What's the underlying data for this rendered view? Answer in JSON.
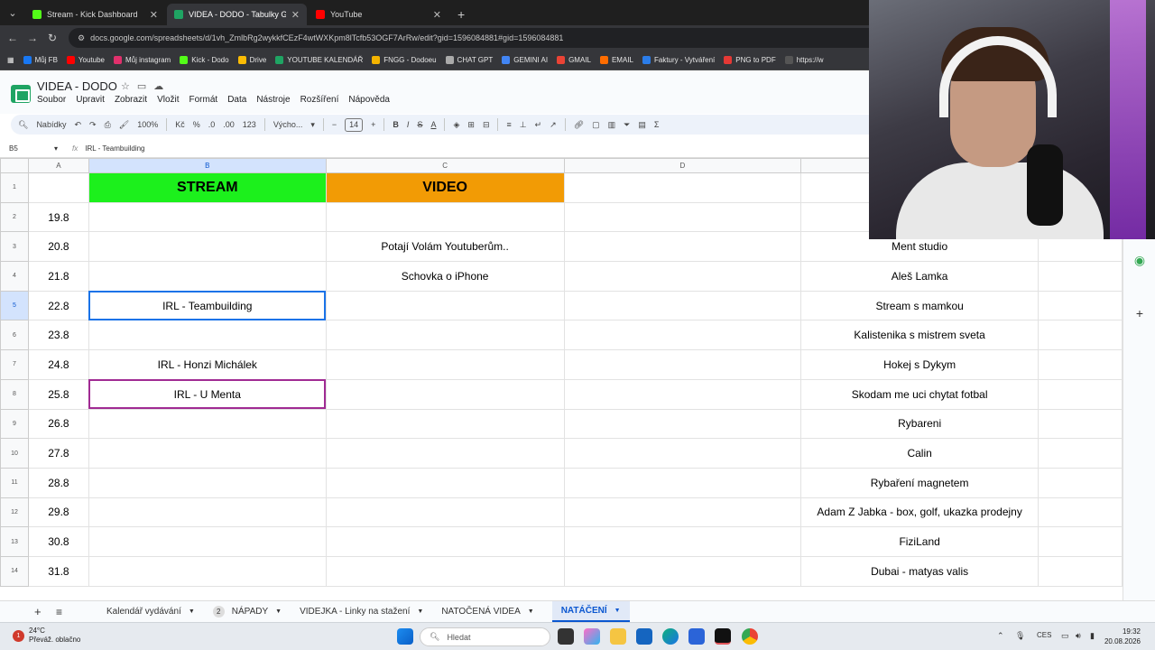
{
  "browser": {
    "tabs": [
      {
        "label": "Stream - Kick Dashboard",
        "color": "#53fc18",
        "active": false
      },
      {
        "label": "VIDEA - DODO - Tabulky Goog",
        "color": "#1fa463",
        "active": true
      },
      {
        "label": "YouTube",
        "color": "#ff0000",
        "active": false
      }
    ],
    "url": "docs.google.com/spreadsheets/d/1vh_ZmlbRg2wykkfCEzF4wtWXKpm8lTcfb53OGF7ArRw/edit?gid=1596084881#gid=1596084881",
    "bookmarks": [
      {
        "label": "Můj FB",
        "color": "#1877f2"
      },
      {
        "label": "Youtube",
        "color": "#ff0000"
      },
      {
        "label": "Můj instagram",
        "color": "#e1306c"
      },
      {
        "label": "Kick - Dodo",
        "color": "#53fc18"
      },
      {
        "label": "Drive",
        "color": "#fbbc04"
      },
      {
        "label": "YOUTUBE KALENDÁŘ",
        "color": "#1fa463"
      },
      {
        "label": "FNGG - Dodoeu",
        "color": "#f4b400"
      },
      {
        "label": "CHAT GPT",
        "color": "#aaaaaa"
      },
      {
        "label": "GEMINI AI",
        "color": "#4285f4"
      },
      {
        "label": "GMAIL",
        "color": "#ea4335"
      },
      {
        "label": "EMAIL",
        "color": "#ff6d00"
      },
      {
        "label": "Faktury - Vytváření",
        "color": "#2b7de9"
      },
      {
        "label": "PNG to PDF",
        "color": "#e53935"
      },
      {
        "label": "https://w",
        "color": "#555555"
      }
    ]
  },
  "sheets": {
    "title": "VIDEA - DODO",
    "menus": [
      "Soubor",
      "Upravit",
      "Zobrazit",
      "Vložit",
      "Formát",
      "Data",
      "Nástroje",
      "Rozšíření",
      "Nápověda"
    ],
    "toolbar": {
      "search": "Nabídky",
      "zoom": "100%",
      "currency": "Kč",
      "percent": "%",
      "dec_down": ".0",
      "dec_up": ".00",
      "num": "123",
      "font": "Výcho...",
      "font_size": "14",
      "bold": "B",
      "italic": "I",
      "strike": "S",
      "textcolor": "A"
    },
    "namebox": "B5",
    "formula": "IRL - Teambuilding",
    "columns": [
      "A",
      "B",
      "C",
      "D"
    ],
    "headers": {
      "stream": "STREAM",
      "video": "VIDEO"
    },
    "rows": [
      {
        "num": "2",
        "date": "19.8",
        "stream": "",
        "video": "",
        "e": ""
      },
      {
        "num": "3",
        "date": "20.8",
        "stream": "",
        "video": "Potají Volám Youtuberům..",
        "e": "Ment studio"
      },
      {
        "num": "4",
        "date": "21.8",
        "stream": "",
        "video": "Schovka o iPhone",
        "e": "Aleš Lamka"
      },
      {
        "num": "5",
        "date": "22.8",
        "stream": "IRL - Teambuilding",
        "video": "",
        "e": "Stream s mamkou"
      },
      {
        "num": "6",
        "date": "23.8",
        "stream": "",
        "video": "",
        "e": "Kalistenika s mistrem sveta"
      },
      {
        "num": "7",
        "date": "24.8",
        "stream": "IRL - Honzi Michálek",
        "video": "",
        "e": "Hokej s Dykym"
      },
      {
        "num": "8",
        "date": "25.8",
        "stream": "IRL - U Menta",
        "video": "",
        "e": "Skodam me uci chytat fotbal"
      },
      {
        "num": "9",
        "date": "26.8",
        "stream": "",
        "video": "",
        "e": "Rybareni"
      },
      {
        "num": "10",
        "date": "27.8",
        "stream": "",
        "video": "",
        "e": "Calin"
      },
      {
        "num": "11",
        "date": "28.8",
        "stream": "",
        "video": "",
        "e": "Rybaření magnetem"
      },
      {
        "num": "12",
        "date": "29.8",
        "stream": "",
        "video": "",
        "e": "Adam Z Jabka - box, golf, ukazka prodejny"
      },
      {
        "num": "13",
        "date": "30.8",
        "stream": "",
        "video": "",
        "e": "FiziLand"
      },
      {
        "num": "14",
        "date": "31.8",
        "stream": "",
        "video": "",
        "e": "Dubai - matyas valis"
      }
    ],
    "sheet_tabs": [
      {
        "label": "Kalendář vydávání",
        "badge": ""
      },
      {
        "label": "NÁPADY",
        "badge": "2"
      },
      {
        "label": "VIDEJKA - Linky na stažení",
        "badge": ""
      },
      {
        "label": "NATOČENÁ VIDEA",
        "badge": ""
      },
      {
        "label": "NATÁČENÍ",
        "badge": "",
        "active": true
      }
    ]
  },
  "taskbar": {
    "temp": "24°C",
    "weather": "Převáž. oblačno",
    "search": "Hledat",
    "lang": "CES",
    "time": "19:32",
    "date": "20.08.2026"
  }
}
